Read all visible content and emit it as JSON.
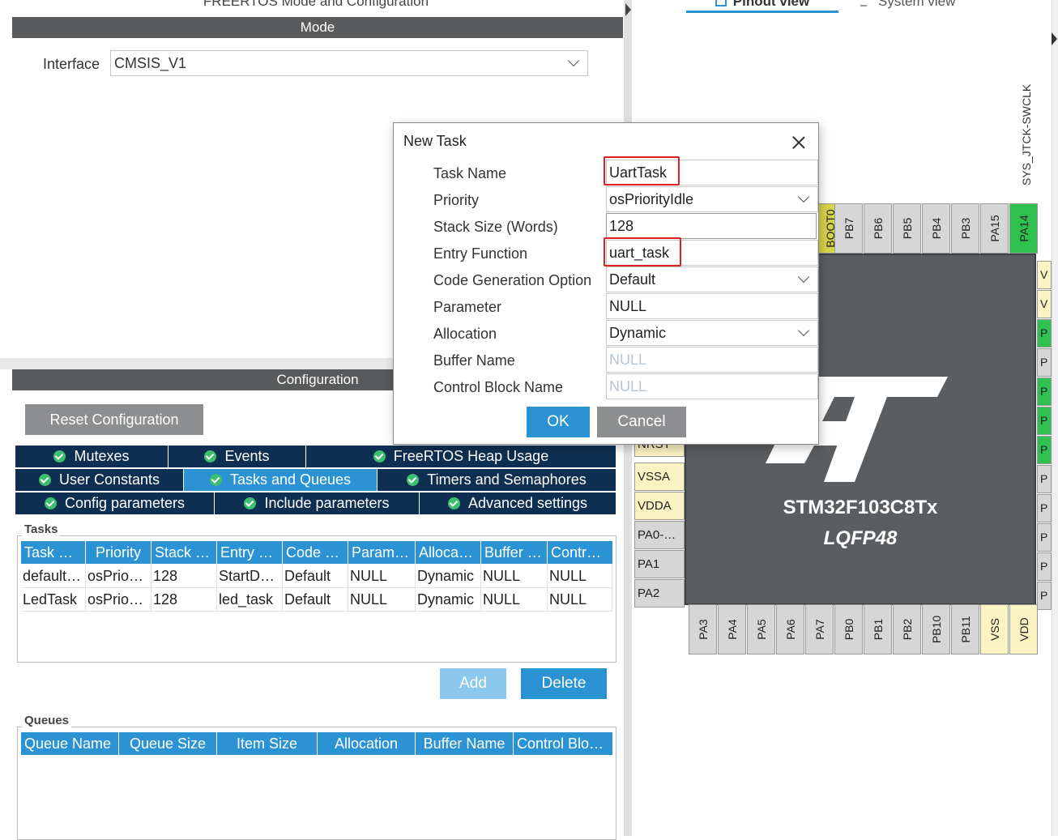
{
  "left": {
    "title": "FREERTOS Mode and Configuration",
    "mode_bar": "Mode",
    "interface_label": "Interface",
    "interface_value": "CMSIS_V1",
    "config_bar": "Configuration",
    "reset_label": "Reset Configuration",
    "tabs": [
      {
        "label": "Mutexes"
      },
      {
        "label": "Events"
      },
      {
        "label": "FreeRTOS Heap Usage"
      },
      {
        "label": "User Constants"
      },
      {
        "label": "Tasks and Queues"
      },
      {
        "label": "Timers and Semaphores"
      },
      {
        "label": "Config parameters"
      },
      {
        "label": "Include parameters"
      },
      {
        "label": "Advanced settings"
      }
    ],
    "active_tab": "Tasks and Queues",
    "tasks": {
      "label": "Tasks",
      "headers": [
        "Task …",
        "Priority",
        "Stack …",
        "Entry …",
        "Code …",
        "Param…",
        "Allocat…",
        "Buffer …",
        "Contro…"
      ],
      "rows": [
        [
          "default…",
          "osPrio…",
          "128",
          "StartD…",
          "Default",
          "NULL",
          "Dynamic",
          "NULL",
          "NULL"
        ],
        [
          "LedTask",
          "osPrio…",
          "128",
          "led_task",
          "Default",
          "NULL",
          "Dynamic",
          "NULL",
          "NULL"
        ]
      ],
      "add_label": "Add",
      "delete_label": "Delete"
    },
    "queues": {
      "label": "Queues",
      "headers": [
        "Queue Name",
        "Queue Size",
        "Item Size",
        "Allocation",
        "Buffer Name",
        "Control Blo…"
      ]
    }
  },
  "right": {
    "pinout_tab": "Pinout view",
    "system_tab": "System view",
    "sys_label": "SYS_JTCK-SWCLK",
    "chip_name": "STM32F103C8Tx",
    "chip_package": "LQFP48",
    "top_pins": [
      "BOOT0",
      "PB7",
      "PB6",
      "PB5",
      "PB4",
      "PB3",
      "PA15",
      "PA14"
    ],
    "left_pins": [
      "NRST",
      "VSSA",
      "VDDA",
      "PA0-…",
      "PA1",
      "PA2"
    ],
    "bottom_pins": [
      "PA3",
      "PA4",
      "PA5",
      "PA6",
      "PA7",
      "PB0",
      "PB1",
      "PB2",
      "PB10",
      "PB11",
      "VSS",
      "VDD"
    ],
    "right_pins": [
      "V",
      "V",
      "P",
      "P",
      "P",
      "P",
      "P",
      "P",
      "P",
      "P",
      "P",
      "P"
    ],
    "colors": {
      "accent": "#2b93d4",
      "tab_dark": "#0f2f52",
      "pin_green": "#2fc04f",
      "pin_yellow": "#fbf3c2",
      "highlight": "#e02020"
    }
  },
  "dialog": {
    "title": "New Task",
    "fields": [
      {
        "label": "Task Name",
        "value": "UartTask"
      },
      {
        "label": "Priority",
        "value": "osPriorityIdle"
      },
      {
        "label": "Stack Size (Words)",
        "value": "128"
      },
      {
        "label": "Entry Function",
        "value": "uart_task"
      },
      {
        "label": "Code Generation Option",
        "value": "Default"
      },
      {
        "label": "Parameter",
        "value": "NULL"
      },
      {
        "label": "Allocation",
        "value": "Dynamic"
      },
      {
        "label": "Buffer Name",
        "placeholder": "NULL"
      },
      {
        "label": "Control Block Name",
        "placeholder": "NULL"
      }
    ],
    "ok_label": "OK",
    "cancel_label": "Cancel"
  }
}
